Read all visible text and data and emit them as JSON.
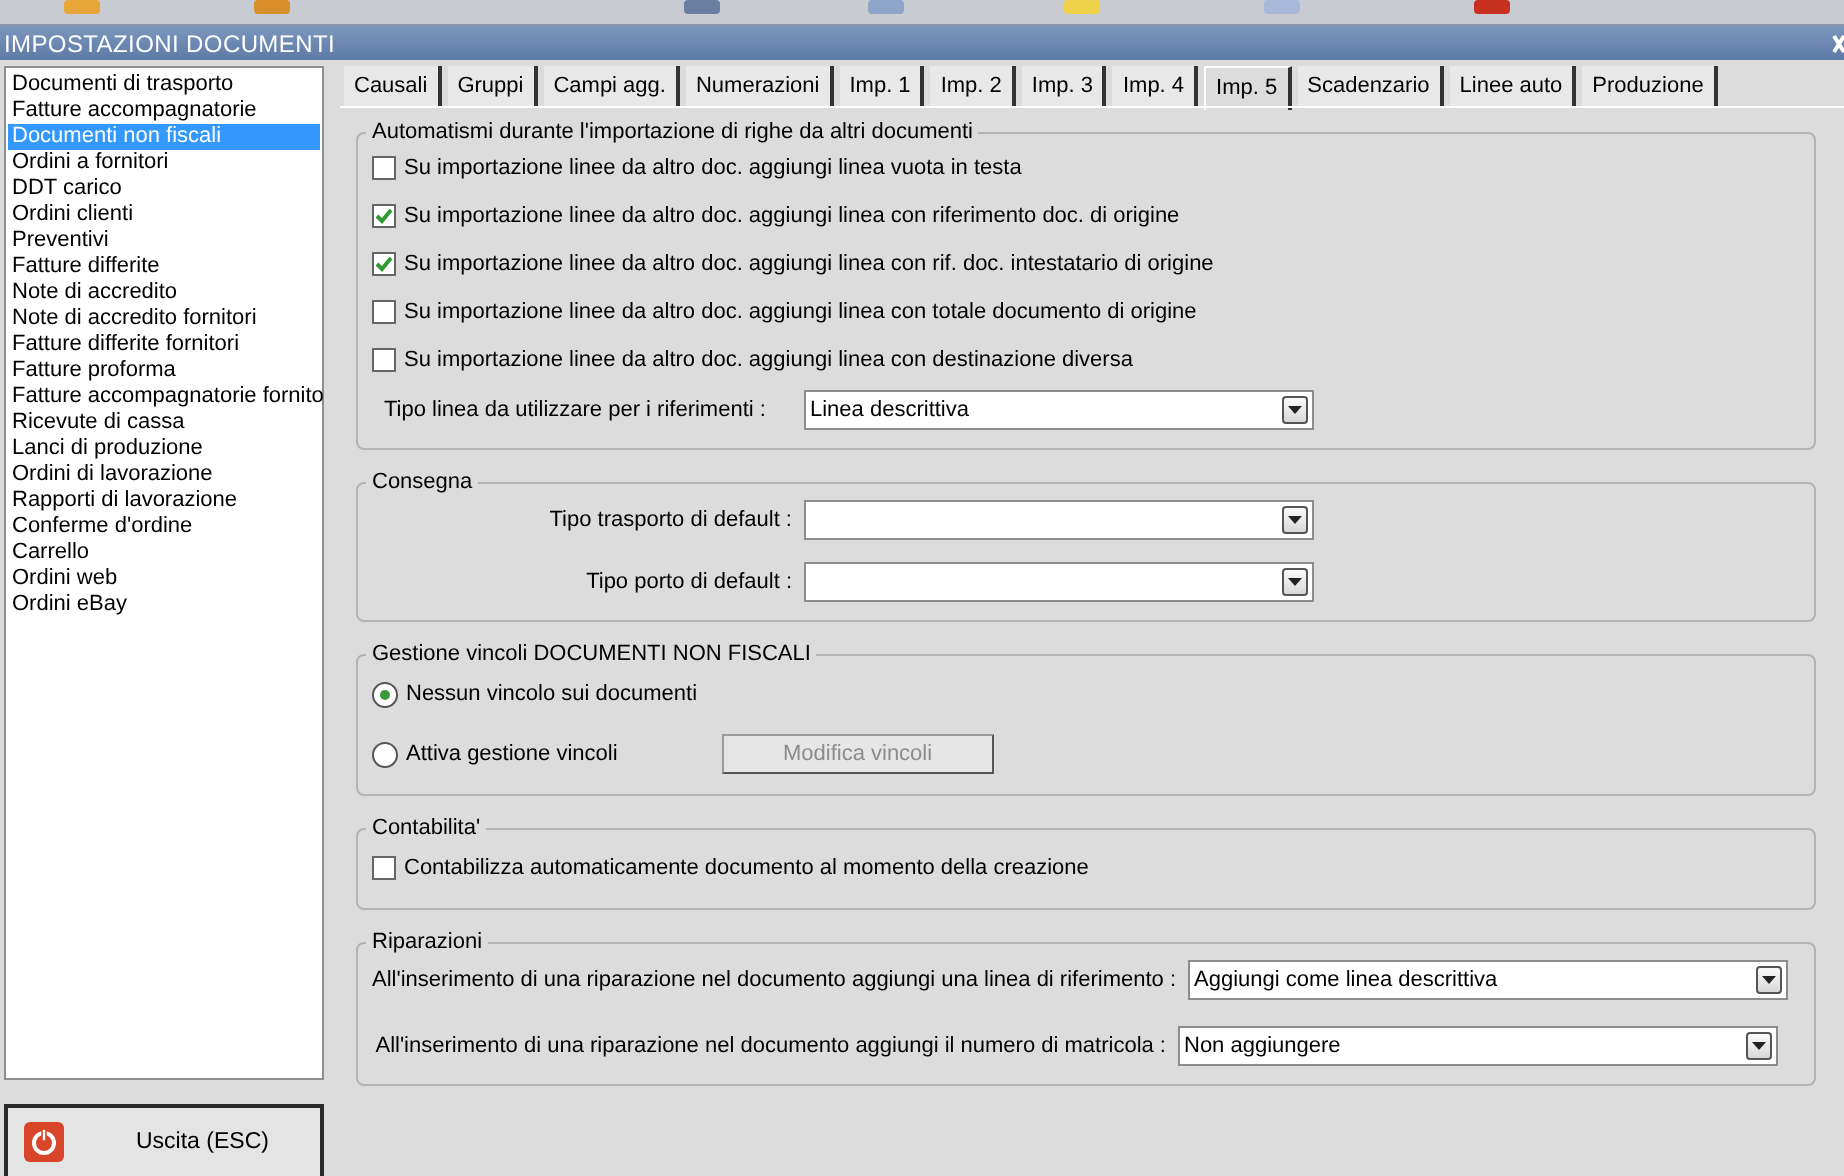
{
  "window": {
    "title": "IMPOSTAZIONI DOCUMENTI"
  },
  "sidebar": {
    "items": [
      {
        "label": "Documenti di trasporto",
        "selected": false
      },
      {
        "label": "Fatture accompagnatorie",
        "selected": false
      },
      {
        "label": "Documenti non fiscali",
        "selected": true
      },
      {
        "label": "Ordini a fornitori",
        "selected": false
      },
      {
        "label": "DDT carico",
        "selected": false
      },
      {
        "label": "Ordini clienti",
        "selected": false
      },
      {
        "label": "Preventivi",
        "selected": false
      },
      {
        "label": "Fatture differite",
        "selected": false
      },
      {
        "label": "Note di accredito",
        "selected": false
      },
      {
        "label": "Note di accredito fornitori",
        "selected": false
      },
      {
        "label": "Fatture differite fornitori",
        "selected": false
      },
      {
        "label": "Fatture proforma",
        "selected": false
      },
      {
        "label": "Fatture accompagnatorie fornito",
        "selected": false
      },
      {
        "label": "Ricevute di cassa",
        "selected": false
      },
      {
        "label": "Lanci di produzione",
        "selected": false
      },
      {
        "label": "Ordini di lavorazione",
        "selected": false
      },
      {
        "label": "Rapporti di lavorazione",
        "selected": false
      },
      {
        "label": "Conferme d'ordine",
        "selected": false
      },
      {
        "label": "Carrello",
        "selected": false
      },
      {
        "label": "Ordini web",
        "selected": false
      },
      {
        "label": "Ordini eBay",
        "selected": false
      }
    ]
  },
  "exit_button": {
    "label": "Uscita (ESC)"
  },
  "tabs": [
    {
      "label": "Causali",
      "selected": false
    },
    {
      "label": "Gruppi",
      "selected": false
    },
    {
      "label": "Campi agg.",
      "selected": false
    },
    {
      "label": "Numerazioni",
      "selected": false
    },
    {
      "label": "Imp. 1",
      "selected": false
    },
    {
      "label": "Imp. 2",
      "selected": false
    },
    {
      "label": "Imp. 3",
      "selected": false
    },
    {
      "label": "Imp. 4",
      "selected": false
    },
    {
      "label": "Imp. 5",
      "selected": true
    },
    {
      "label": "Scadenzario",
      "selected": false
    },
    {
      "label": "Linee auto",
      "selected": false
    },
    {
      "label": "Produzione",
      "selected": false
    }
  ],
  "groups": [
    {
      "title": "Automatismi durante l'importazione di righe da altri documenti",
      "rows": [
        {
          "kind": "checkbox",
          "label": "Su importazione linee da altro doc. aggiungi linea vuota in testa",
          "checked": false
        },
        {
          "kind": "checkbox",
          "label": "Su importazione linee da altro doc. aggiungi linea con riferimento doc. di origine",
          "checked": true
        },
        {
          "kind": "checkbox",
          "label": "Su importazione linee da altro doc. aggiungi linea con rif. doc. intestatario di origine",
          "checked": true
        },
        {
          "kind": "checkbox",
          "label": "Su importazione linee da altro doc. aggiungi linea con totale documento di origine",
          "checked": false
        },
        {
          "kind": "checkbox",
          "label": "Su importazione linee da altro doc. aggiungi linea con destinazione diversa",
          "checked": false
        },
        {
          "kind": "combo",
          "label": "Tipo linea da utilizzare per i riferimenti :",
          "value": "Linea descrittiva"
        }
      ]
    },
    {
      "title": "Consegna",
      "rows": [
        {
          "kind": "combo",
          "label": "Tipo trasporto di default :"
        },
        {
          "kind": "combo",
          "label": "Tipo porto di default :"
        }
      ]
    },
    {
      "title": "Gestione vincoli DOCUMENTI NON FISCALI",
      "rows": [
        {
          "kind": "radio",
          "label": "Nessun vincolo sui documenti",
          "selected": true
        },
        {
          "kind": "radio",
          "label": "Attiva gestione vincoli",
          "selected": false,
          "button": {
            "label": "Modifica vincoli",
            "disabled": true
          }
        }
      ]
    },
    {
      "title": "Contabilita'",
      "rows": [
        {
          "kind": "checkbox",
          "label": "Contabilizza automaticamente documento al momento della creazione",
          "checked": false
        }
      ]
    },
    {
      "title": "Riparazioni",
      "rows": [
        {
          "kind": "combo",
          "label": "All'inserimento di una riparazione nel documento aggiungi una linea di riferimento :",
          "value": "Aggiungi come linea descrittiva"
        },
        {
          "kind": "combo",
          "label": "All'inserimento di una riparazione nel documento aggiungi il numero di matricola :",
          "value": "Non aggiungere"
        }
      ]
    }
  ]
}
